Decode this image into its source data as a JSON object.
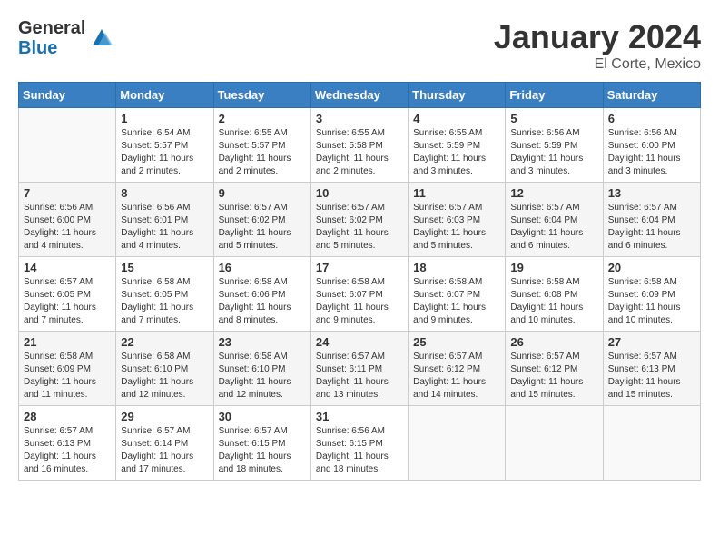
{
  "header": {
    "logo_general": "General",
    "logo_blue": "Blue",
    "month_year": "January 2024",
    "location": "El Corte, Mexico"
  },
  "days_of_week": [
    "Sunday",
    "Monday",
    "Tuesday",
    "Wednesday",
    "Thursday",
    "Friday",
    "Saturday"
  ],
  "weeks": [
    [
      {
        "day": "",
        "info": ""
      },
      {
        "day": "1",
        "info": "Sunrise: 6:54 AM\nSunset: 5:57 PM\nDaylight: 11 hours\nand 2 minutes."
      },
      {
        "day": "2",
        "info": "Sunrise: 6:55 AM\nSunset: 5:57 PM\nDaylight: 11 hours\nand 2 minutes."
      },
      {
        "day": "3",
        "info": "Sunrise: 6:55 AM\nSunset: 5:58 PM\nDaylight: 11 hours\nand 2 minutes."
      },
      {
        "day": "4",
        "info": "Sunrise: 6:55 AM\nSunset: 5:59 PM\nDaylight: 11 hours\nand 3 minutes."
      },
      {
        "day": "5",
        "info": "Sunrise: 6:56 AM\nSunset: 5:59 PM\nDaylight: 11 hours\nand 3 minutes."
      },
      {
        "day": "6",
        "info": "Sunrise: 6:56 AM\nSunset: 6:00 PM\nDaylight: 11 hours\nand 3 minutes."
      }
    ],
    [
      {
        "day": "7",
        "info": "Sunrise: 6:56 AM\nSunset: 6:00 PM\nDaylight: 11 hours\nand 4 minutes."
      },
      {
        "day": "8",
        "info": "Sunrise: 6:56 AM\nSunset: 6:01 PM\nDaylight: 11 hours\nand 4 minutes."
      },
      {
        "day": "9",
        "info": "Sunrise: 6:57 AM\nSunset: 6:02 PM\nDaylight: 11 hours\nand 5 minutes."
      },
      {
        "day": "10",
        "info": "Sunrise: 6:57 AM\nSunset: 6:02 PM\nDaylight: 11 hours\nand 5 minutes."
      },
      {
        "day": "11",
        "info": "Sunrise: 6:57 AM\nSunset: 6:03 PM\nDaylight: 11 hours\nand 5 minutes."
      },
      {
        "day": "12",
        "info": "Sunrise: 6:57 AM\nSunset: 6:04 PM\nDaylight: 11 hours\nand 6 minutes."
      },
      {
        "day": "13",
        "info": "Sunrise: 6:57 AM\nSunset: 6:04 PM\nDaylight: 11 hours\nand 6 minutes."
      }
    ],
    [
      {
        "day": "14",
        "info": "Sunrise: 6:57 AM\nSunset: 6:05 PM\nDaylight: 11 hours\nand 7 minutes."
      },
      {
        "day": "15",
        "info": "Sunrise: 6:58 AM\nSunset: 6:05 PM\nDaylight: 11 hours\nand 7 minutes."
      },
      {
        "day": "16",
        "info": "Sunrise: 6:58 AM\nSunset: 6:06 PM\nDaylight: 11 hours\nand 8 minutes."
      },
      {
        "day": "17",
        "info": "Sunrise: 6:58 AM\nSunset: 6:07 PM\nDaylight: 11 hours\nand 9 minutes."
      },
      {
        "day": "18",
        "info": "Sunrise: 6:58 AM\nSunset: 6:07 PM\nDaylight: 11 hours\nand 9 minutes."
      },
      {
        "day": "19",
        "info": "Sunrise: 6:58 AM\nSunset: 6:08 PM\nDaylight: 11 hours\nand 10 minutes."
      },
      {
        "day": "20",
        "info": "Sunrise: 6:58 AM\nSunset: 6:09 PM\nDaylight: 11 hours\nand 10 minutes."
      }
    ],
    [
      {
        "day": "21",
        "info": "Sunrise: 6:58 AM\nSunset: 6:09 PM\nDaylight: 11 hours\nand 11 minutes."
      },
      {
        "day": "22",
        "info": "Sunrise: 6:58 AM\nSunset: 6:10 PM\nDaylight: 11 hours\nand 12 minutes."
      },
      {
        "day": "23",
        "info": "Sunrise: 6:58 AM\nSunset: 6:10 PM\nDaylight: 11 hours\nand 12 minutes."
      },
      {
        "day": "24",
        "info": "Sunrise: 6:57 AM\nSunset: 6:11 PM\nDaylight: 11 hours\nand 13 minutes."
      },
      {
        "day": "25",
        "info": "Sunrise: 6:57 AM\nSunset: 6:12 PM\nDaylight: 11 hours\nand 14 minutes."
      },
      {
        "day": "26",
        "info": "Sunrise: 6:57 AM\nSunset: 6:12 PM\nDaylight: 11 hours\nand 15 minutes."
      },
      {
        "day": "27",
        "info": "Sunrise: 6:57 AM\nSunset: 6:13 PM\nDaylight: 11 hours\nand 15 minutes."
      }
    ],
    [
      {
        "day": "28",
        "info": "Sunrise: 6:57 AM\nSunset: 6:13 PM\nDaylight: 11 hours\nand 16 minutes."
      },
      {
        "day": "29",
        "info": "Sunrise: 6:57 AM\nSunset: 6:14 PM\nDaylight: 11 hours\nand 17 minutes."
      },
      {
        "day": "30",
        "info": "Sunrise: 6:57 AM\nSunset: 6:15 PM\nDaylight: 11 hours\nand 18 minutes."
      },
      {
        "day": "31",
        "info": "Sunrise: 6:56 AM\nSunset: 6:15 PM\nDaylight: 11 hours\nand 18 minutes."
      },
      {
        "day": "",
        "info": ""
      },
      {
        "day": "",
        "info": ""
      },
      {
        "day": "",
        "info": ""
      }
    ]
  ]
}
